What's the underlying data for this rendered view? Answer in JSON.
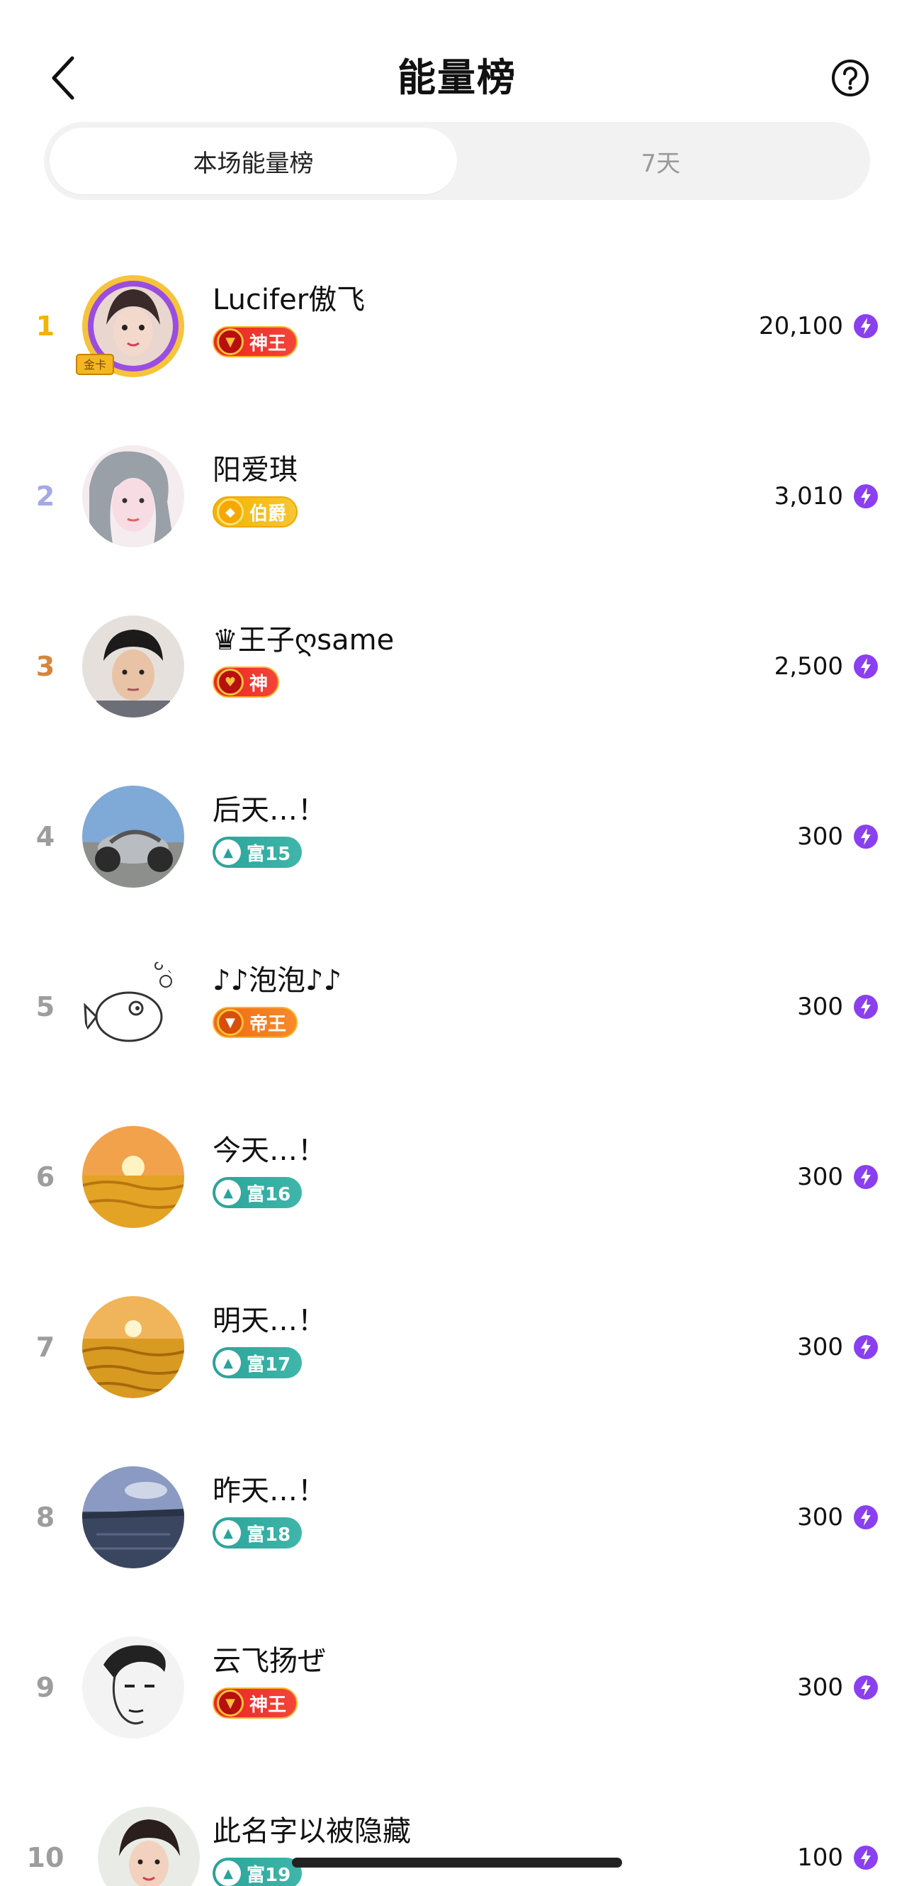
{
  "header": {
    "title": "能量榜"
  },
  "tabs": [
    {
      "label": "本场能量榜",
      "active": true
    },
    {
      "label": "7天",
      "active": false
    }
  ],
  "ranking": [
    {
      "rank": "1",
      "name": "Lucifer傲飞",
      "badge": "神王",
      "badge_style": "red",
      "score": "20,100"
    },
    {
      "rank": "2",
      "name": "阳爱琪",
      "badge": "伯爵",
      "badge_style": "gold",
      "score": "3,010"
    },
    {
      "rank": "3",
      "name": "♛王子ღsame",
      "badge": "神",
      "badge_style": "red",
      "score": "2,500"
    },
    {
      "rank": "4",
      "name": "后天…！",
      "badge": "富15",
      "badge_style": "teal",
      "score": "300"
    },
    {
      "rank": "5",
      "name": "♪♪泡泡♪♪",
      "badge": "帝王",
      "badge_style": "orange",
      "score": "300"
    },
    {
      "rank": "6",
      "name": "今天…！",
      "badge": "富16",
      "badge_style": "teal",
      "score": "300"
    },
    {
      "rank": "7",
      "name": "明天…！",
      "badge": "富17",
      "badge_style": "teal",
      "score": "300"
    },
    {
      "rank": "8",
      "name": "昨天…！",
      "badge": "富18",
      "badge_style": "teal",
      "score": "300"
    },
    {
      "rank": "9",
      "name": "云飞扬ぜ",
      "badge": "神王",
      "badge_style": "red",
      "score": "300"
    },
    {
      "rank": "10",
      "name": "此名字以被隐藏",
      "badge": "富19",
      "badge_style": "teal",
      "score": "100"
    }
  ],
  "icons": {
    "back": "chevron-left-icon",
    "help": "question-circle-icon",
    "energy": "lightning-icon"
  },
  "colors": {
    "rank1": "#f2b400",
    "rank2": "#a6a8e6",
    "rank3": "#d5863e",
    "energy": "#8a3ff0",
    "badge_red": "#e8261f",
    "badge_teal": "#2aa39a"
  }
}
